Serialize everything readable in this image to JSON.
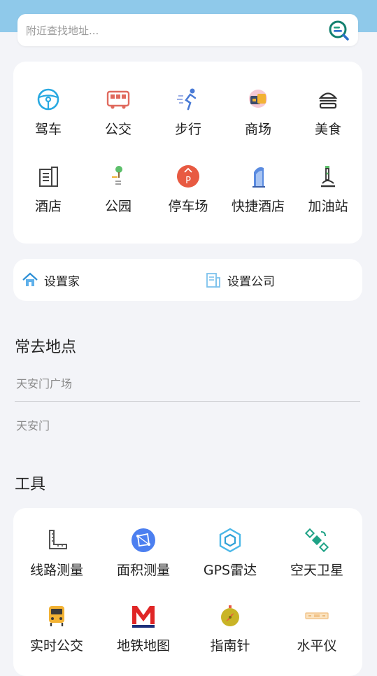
{
  "search": {
    "placeholder": "附近查找地址..."
  },
  "categories": [
    {
      "label": "驾车",
      "icon": "steering-wheel-icon"
    },
    {
      "label": "公交",
      "icon": "bus-icon"
    },
    {
      "label": "步行",
      "icon": "walking-person-icon"
    },
    {
      "label": "商场",
      "icon": "shopping-mall-icon"
    },
    {
      "label": "美食",
      "icon": "burger-icon"
    },
    {
      "label": "酒店",
      "icon": "hotel-building-icon"
    },
    {
      "label": "公园",
      "icon": "park-tree-icon"
    },
    {
      "label": "停车场",
      "icon": "parking-icon"
    },
    {
      "label": "快捷酒店",
      "icon": "tower-hotel-icon"
    },
    {
      "label": "加油站",
      "icon": "gas-station-icon"
    }
  ],
  "shortcuts": {
    "home": {
      "label": "设置家",
      "icon": "home-icon"
    },
    "company": {
      "label": "设置公司",
      "icon": "office-building-icon"
    }
  },
  "frequent": {
    "title": "常去地点",
    "items": [
      "天安门广场",
      "天安门"
    ]
  },
  "tools": {
    "title": "工具",
    "items": [
      {
        "label": "线路测量",
        "icon": "ruler-icon"
      },
      {
        "label": "面积测量",
        "icon": "area-measure-icon"
      },
      {
        "label": "GPS雷达",
        "icon": "hexagon-radar-icon"
      },
      {
        "label": "空天卫星",
        "icon": "satellite-icon"
      },
      {
        "label": "实时公交",
        "icon": "realtime-bus-icon"
      },
      {
        "label": "地铁地图",
        "icon": "metro-icon"
      },
      {
        "label": "指南针",
        "icon": "compass-icon"
      },
      {
        "label": "水平仪",
        "icon": "level-icon"
      }
    ]
  },
  "colors": {
    "topbar": "#8fc9ea",
    "background": "#f3f4f8",
    "search_icon": "#1a8f7a"
  }
}
